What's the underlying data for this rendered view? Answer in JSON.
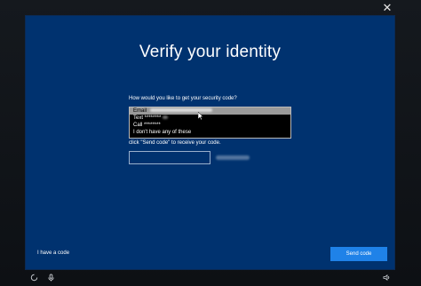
{
  "window": {
    "close_glyph": "✕"
  },
  "dialog": {
    "title": "Verify your identity",
    "question": "How would you like to get your security code?",
    "options": [
      {
        "label": "Email ",
        "masked": true,
        "selected": true
      },
      {
        "label": "Text ********",
        "masked": true,
        "selected": false
      },
      {
        "label": "Call ********",
        "masked": false,
        "selected": false
      },
      {
        "label": "I don't have any of these",
        "masked": false,
        "selected": false
      }
    ],
    "hint": "click \"Send code\" to receive your code.",
    "code_input": {
      "value": "",
      "placeholder": ""
    },
    "have_code_link": "I have a code",
    "send_button": "Send code"
  },
  "taskbar": {
    "icons": [
      "accessibility-icon",
      "microphone-icon",
      "volume-icon"
    ]
  },
  "colors": {
    "panel": "#00326f",
    "accent": "#1f82e8",
    "frame": "#15191e"
  }
}
